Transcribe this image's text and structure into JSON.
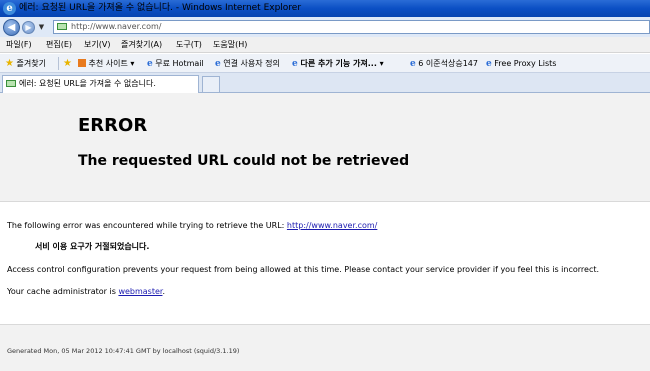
{
  "window": {
    "title": "에러: 요청된 URL을 가져올 수 없습니다. - Windows Internet Explorer"
  },
  "address_bar": {
    "url": "http://www.naver.com/"
  },
  "menu": [
    "파일(F)",
    "편집(E)",
    "보기(V)",
    "즐겨찾기(A)",
    "도구(T)",
    "도움말(H)"
  ],
  "favorites_bar": {
    "favorites_label": "즐겨찾기",
    "items": [
      {
        "label": "추천 사이트 ▾",
        "icon": "orange-square-icon"
      },
      {
        "label": "무료 Hotmail",
        "icon": "ie-page-icon"
      },
      {
        "label": "연결 사용자 정의",
        "icon": "ie-page-icon"
      },
      {
        "label": "다른 추가 기능 가져... ▾",
        "icon": "ie-page-icon"
      },
      {
        "label": "6 이준석상승147",
        "icon": "ie-page-icon"
      },
      {
        "label": "Free Proxy Lists",
        "icon": "ie-page-icon"
      }
    ]
  },
  "tab": {
    "label": "에러: 요청된 URL을 가져올 수 없습니다."
  },
  "page": {
    "heading": "ERROR",
    "subheading": "The requested URL could not be retrieved",
    "intro": "The following error was encountered while trying to retrieve the URL: ",
    "url_link": "http://www.naver.com/",
    "denied": "서비 이용 요구가 거절되었습니다.",
    "explanation": "Access control configuration prevents your request from being allowed at this time. Please contact your service provider if you feel this is incorrect.",
    "admin_prefix": "Your cache administrator is ",
    "admin_link": "webmaster",
    "admin_suffix": ".",
    "footer": "Generated Mon, 05 Mar 2012 10:47:41 GMT by localhost (squid/3.1.19)"
  }
}
